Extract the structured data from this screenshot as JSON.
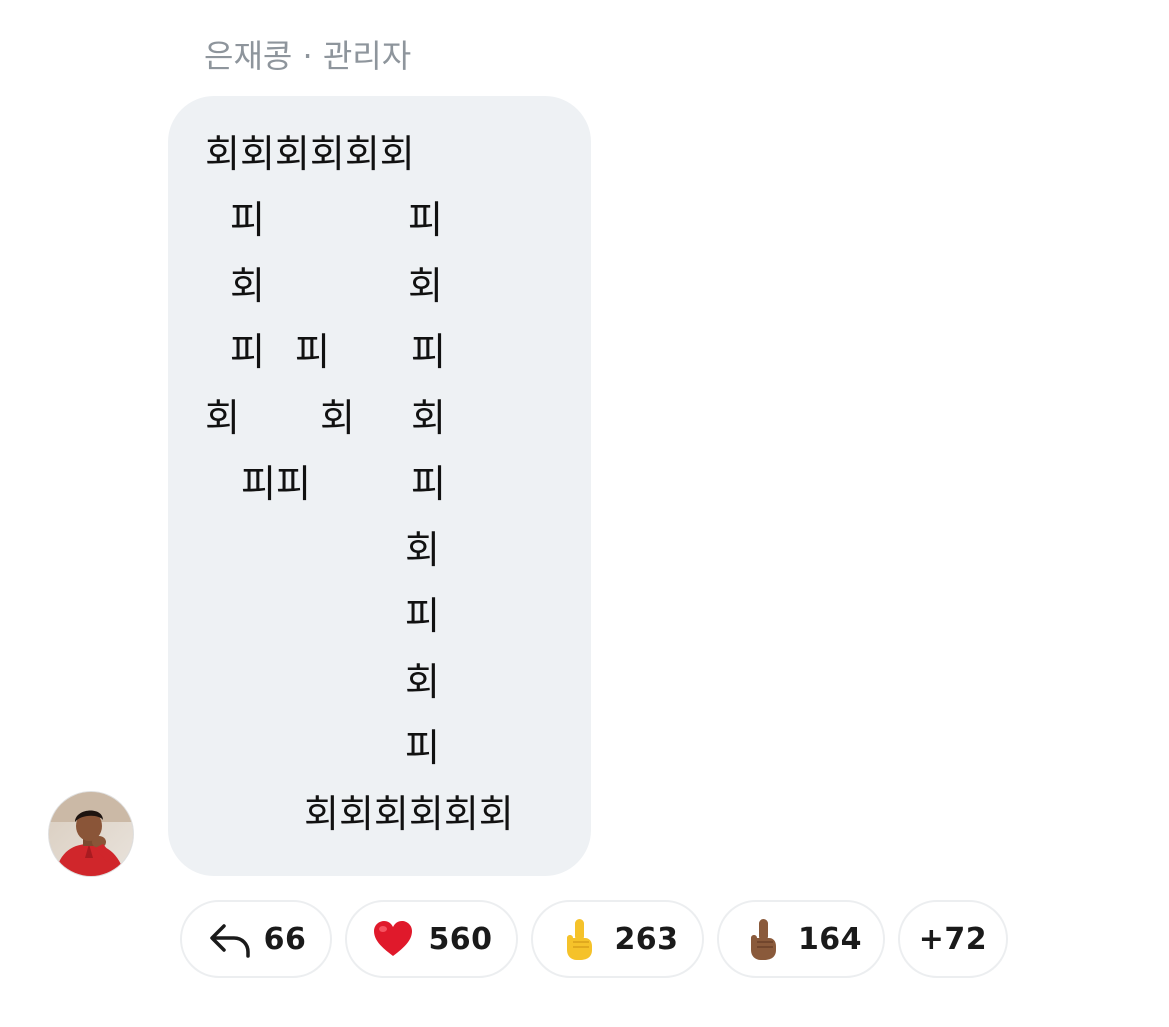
{
  "message": {
    "sender_line": "은재콩 · 관리자",
    "lines": [
      "회회회회회회",
      "피",
      "피",
      "회",
      "회",
      "피",
      "피",
      "피",
      "회",
      "회",
      "회",
      "피피",
      "피",
      "회",
      "피",
      "회",
      "피",
      "회회회회회회"
    ]
  },
  "reactions": [
    {
      "icon": "reply-arrow-icon",
      "count": "66"
    },
    {
      "icon": "red-heart-icon",
      "count": "560",
      "color": "#e0192b"
    },
    {
      "icon": "middle-finger-light-icon",
      "count": "263",
      "color": "#f5c22a"
    },
    {
      "icon": "middle-finger-dark-icon",
      "count": "164",
      "color": "#8a5a3b"
    },
    {
      "more_label": "+72"
    }
  ]
}
